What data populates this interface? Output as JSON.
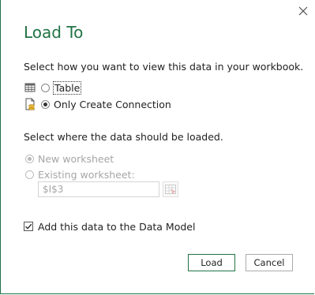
{
  "dialog": {
    "title": "Load To",
    "close_icon": "close-icon"
  },
  "view_section": {
    "prompt": "Select how you want to view this data in your workbook.",
    "options": [
      {
        "label": "Table",
        "icon": "table-icon",
        "selected": false
      },
      {
        "label": "Only Create Connection",
        "icon": "connection-icon",
        "selected": true
      }
    ]
  },
  "location_section": {
    "prompt": "Select where the data should be loaded.",
    "options": [
      {
        "label": "New worksheet",
        "selected": true,
        "enabled": false
      },
      {
        "label": "Existing worksheet:",
        "selected": false,
        "enabled": false
      }
    ],
    "cell_value": "$I$3",
    "range_picker_icon": "range-picker-icon"
  },
  "data_model": {
    "label": "Add this data to the Data Model",
    "checked": true
  },
  "buttons": {
    "load": "Load",
    "cancel": "Cancel"
  },
  "colors": {
    "accent": "#217346",
    "border": "#1e7145"
  }
}
